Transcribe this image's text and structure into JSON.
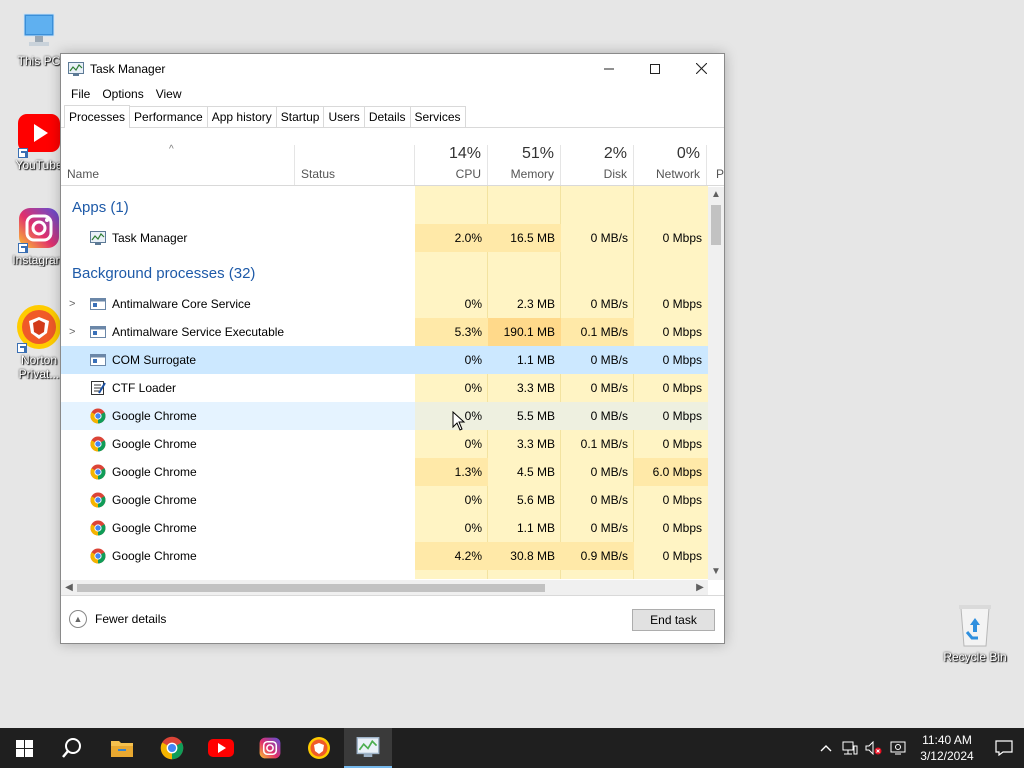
{
  "desktop": {
    "icons": [
      {
        "label": "This PC"
      },
      {
        "label": "YouTube"
      },
      {
        "label": "Instagram"
      },
      {
        "label": "Norton Privat..."
      },
      {
        "label": "Recycle Bin"
      }
    ]
  },
  "window": {
    "title": "Task Manager",
    "menu": [
      "File",
      "Options",
      "View"
    ],
    "tabs": [
      "Processes",
      "Performance",
      "App history",
      "Startup",
      "Users",
      "Details",
      "Services"
    ],
    "active_tab": "Processes",
    "columns": {
      "name": "Name",
      "status": "Status",
      "cpu": {
        "pct": "14%",
        "label": "CPU"
      },
      "memory": {
        "pct": "51%",
        "label": "Memory"
      },
      "disk": {
        "pct": "2%",
        "label": "Disk"
      },
      "network": {
        "pct": "0%",
        "label": "Network"
      },
      "power_partial": "P"
    },
    "groups": {
      "apps": "Apps (1)",
      "background": "Background processes (32)"
    },
    "rows": [
      {
        "name": "Task Manager",
        "cpu": "2.0%",
        "memory": "16.5 MB",
        "disk": "0 MB/s",
        "network": "0 Mbps"
      },
      {
        "name": "Antimalware Core Service",
        "cpu": "0%",
        "memory": "2.3 MB",
        "disk": "0 MB/s",
        "network": "0 Mbps"
      },
      {
        "name": "Antimalware Service Executable",
        "cpu": "5.3%",
        "memory": "190.1 MB",
        "disk": "0.1 MB/s",
        "network": "0 Mbps"
      },
      {
        "name": "COM Surrogate",
        "cpu": "0%",
        "memory": "1.1 MB",
        "disk": "0 MB/s",
        "network": "0 Mbps"
      },
      {
        "name": "CTF Loader",
        "cpu": "0%",
        "memory": "3.3 MB",
        "disk": "0 MB/s",
        "network": "0 Mbps"
      },
      {
        "name": "Google Chrome",
        "cpu": "0%",
        "memory": "5.5 MB",
        "disk": "0 MB/s",
        "network": "0 Mbps"
      },
      {
        "name": "Google Chrome",
        "cpu": "0%",
        "memory": "3.3 MB",
        "disk": "0.1 MB/s",
        "network": "0 Mbps"
      },
      {
        "name": "Google Chrome",
        "cpu": "1.3%",
        "memory": "4.5 MB",
        "disk": "0 MB/s",
        "network": "6.0 Mbps"
      },
      {
        "name": "Google Chrome",
        "cpu": "0%",
        "memory": "5.6 MB",
        "disk": "0 MB/s",
        "network": "0 Mbps"
      },
      {
        "name": "Google Chrome",
        "cpu": "0%",
        "memory": "1.1 MB",
        "disk": "0 MB/s",
        "network": "0 Mbps"
      },
      {
        "name": "Google Chrome",
        "cpu": "4.2%",
        "memory": "30.8 MB",
        "disk": "0.9 MB/s",
        "network": "0 Mbps"
      }
    ],
    "footer": {
      "fewer_details": "Fewer details",
      "end_task": "End task"
    }
  },
  "taskbar": {
    "time": "11:40 AM",
    "date": "3/12/2024"
  },
  "colors": {
    "accent": "#1e5aa8",
    "heat_low": "#fff4c4",
    "heat_mid": "#ffe9a8",
    "selection": "#cce8ff",
    "taskbar": "#1f1f1f"
  }
}
